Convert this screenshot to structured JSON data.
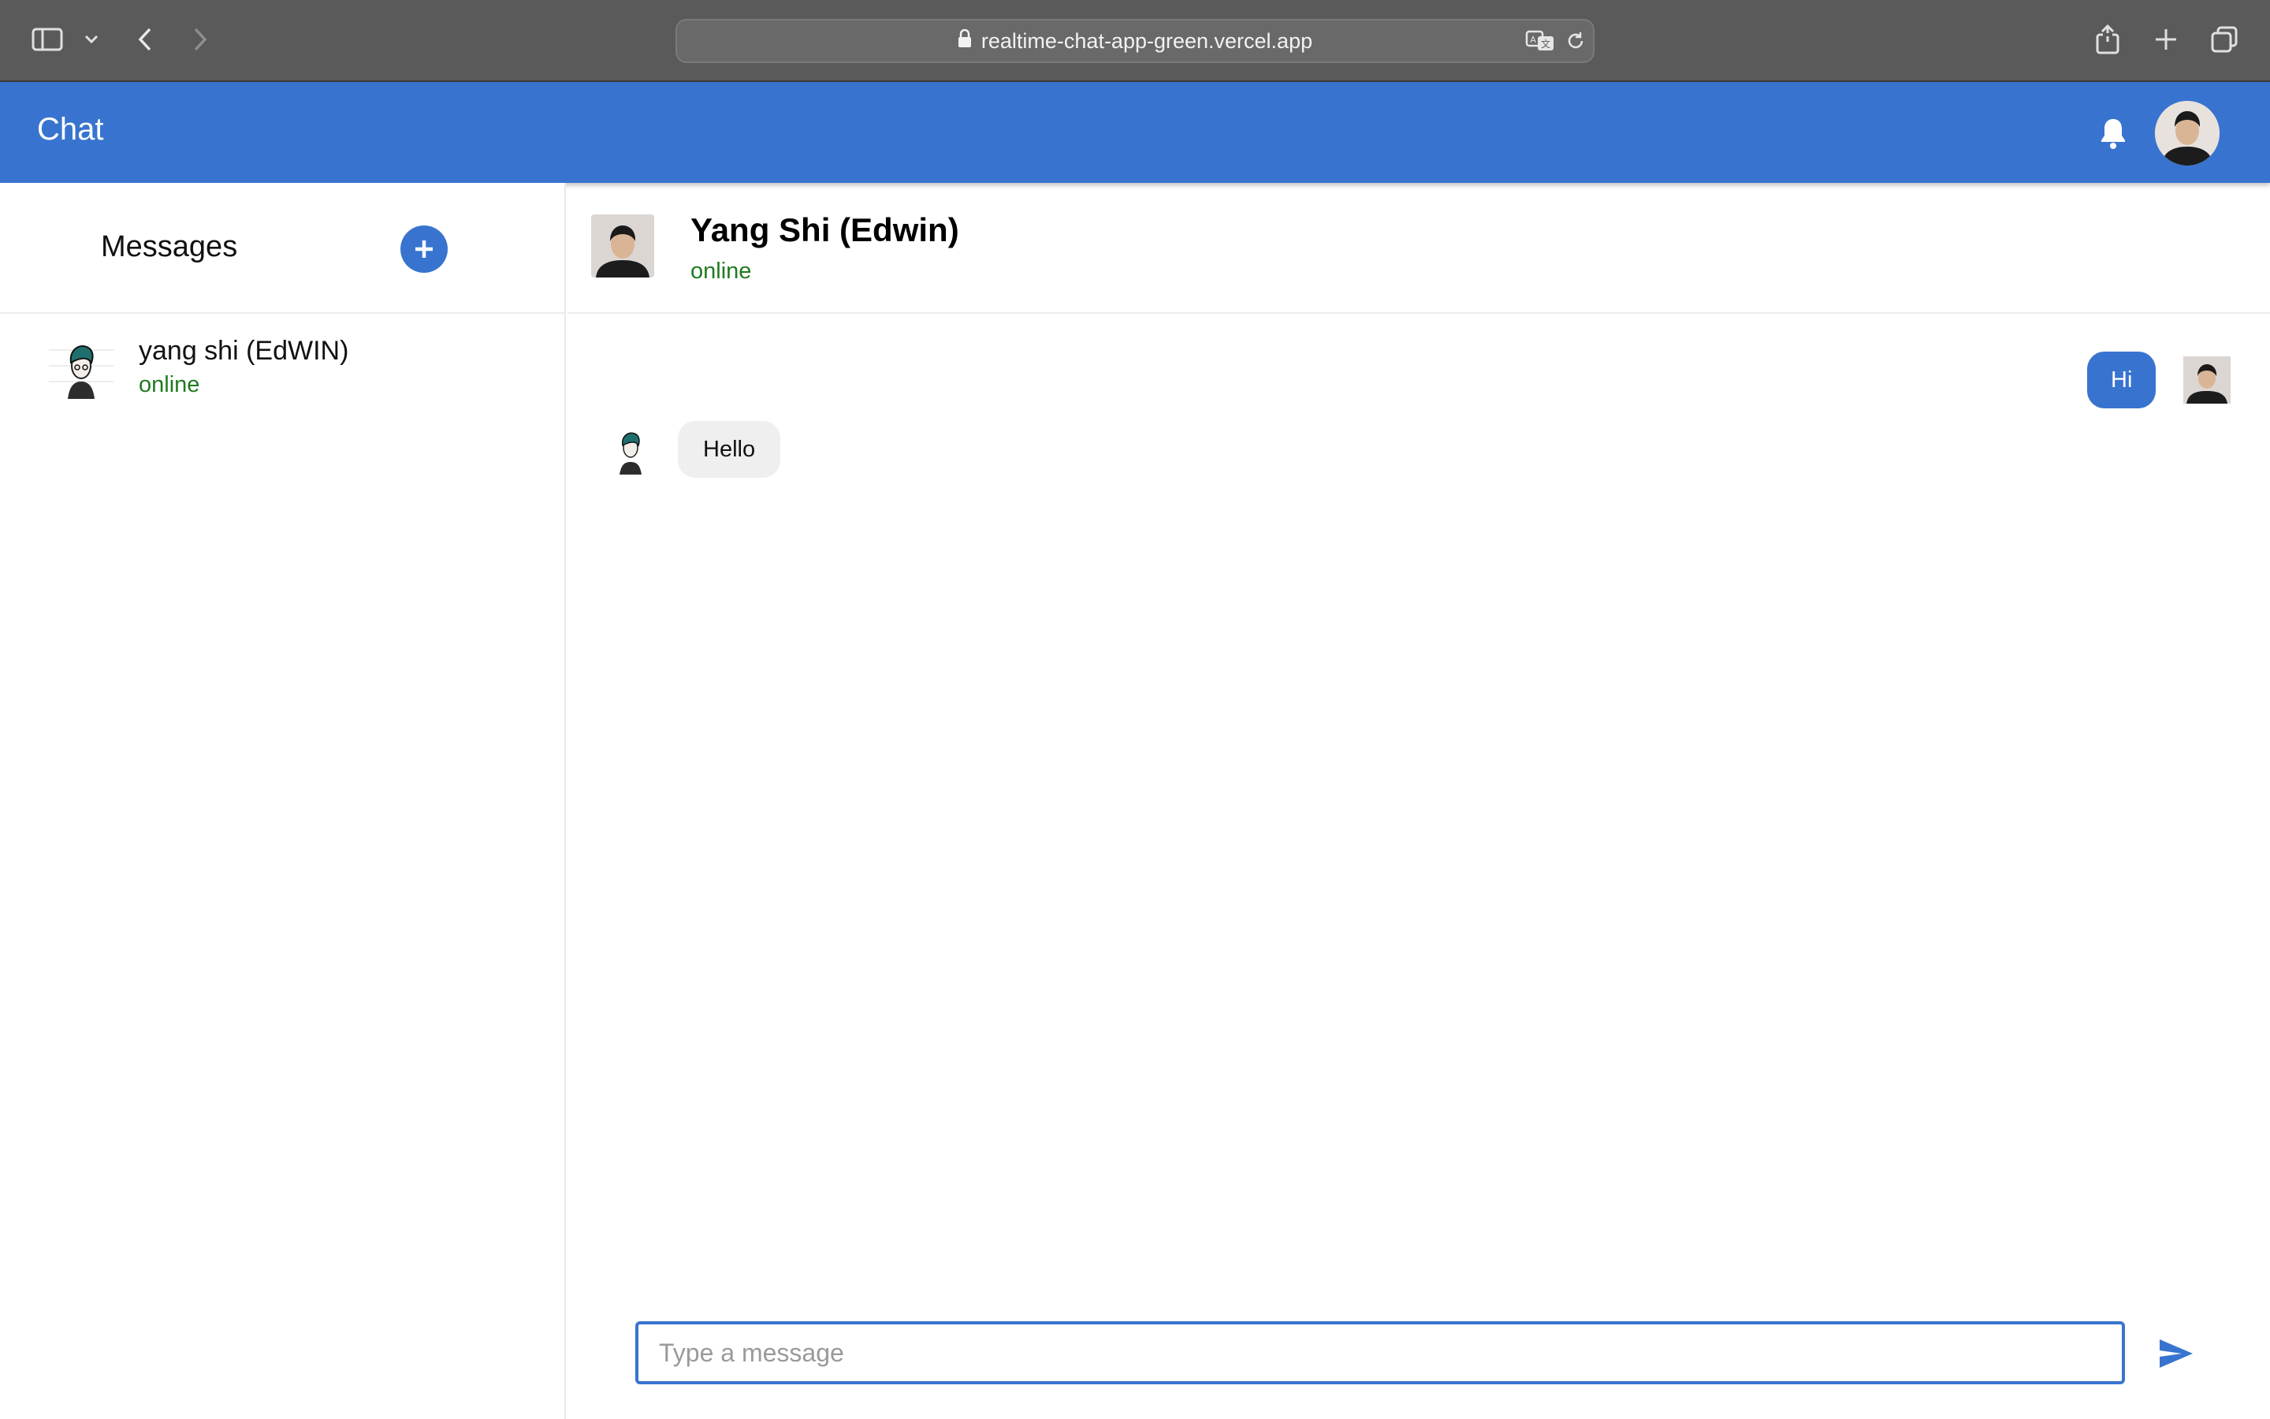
{
  "browser": {
    "url": "realtime-chat-app-green.vercel.app"
  },
  "header": {
    "title": "Chat"
  },
  "sidebar": {
    "title": "Messages",
    "contacts": [
      {
        "name": "yang shi (EdWIN)",
        "status": "online"
      }
    ]
  },
  "chat": {
    "contact_name": "Yang Shi (Edwin)",
    "contact_status": "online",
    "messages": [
      {
        "direction": "outgoing",
        "text": "Hi"
      },
      {
        "direction": "incoming",
        "text": "Hello"
      }
    ],
    "input_placeholder": "Type a message"
  },
  "colors": {
    "accent": "#3874cf",
    "online": "#1f7a1f",
    "incoming_bubble": "#efefef"
  }
}
